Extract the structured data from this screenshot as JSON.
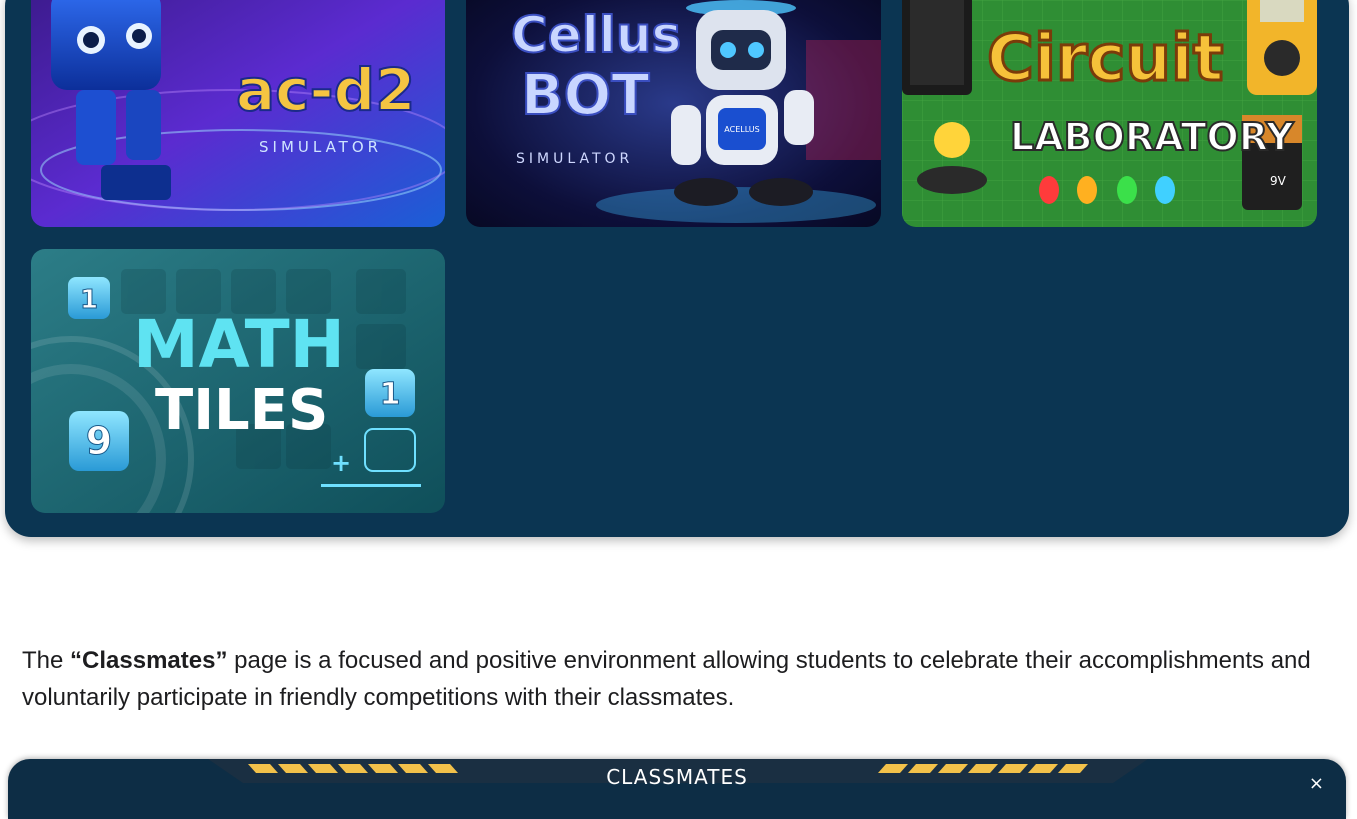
{
  "games": [
    {
      "title": "ac-d2",
      "subtitle": "SIMULATOR"
    },
    {
      "title_line1": "Cellus",
      "title_line2": "BOT",
      "subtitle": "SIMULATOR",
      "badge": "ACELLUS"
    },
    {
      "title_line1": "Circuit",
      "title_line2": "LABORATORY",
      "battery": "9V"
    },
    {
      "title_line1": "MATH",
      "title_line2": "TILES",
      "tile_a": "1",
      "tile_b": "9",
      "tile_c": "1",
      "operator": "+"
    }
  ],
  "description": {
    "prefix": "The ",
    "highlight": "“Classmates”",
    "suffix": " page is a focused and positive environment allowing students to celebrate their accomplishments and voluntarily participate in friendly competitions with their classmates."
  },
  "classmates_panel": {
    "title": "CLASSMATES",
    "close": "×"
  }
}
